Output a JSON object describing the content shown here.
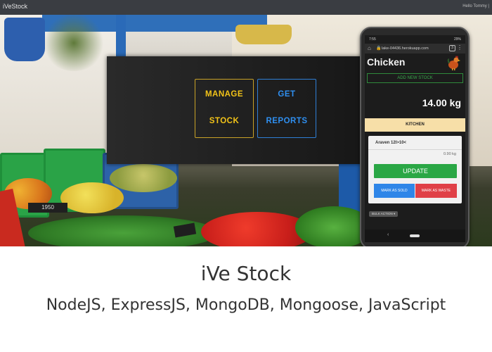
{
  "navbar": {
    "brand": "iVeStock",
    "greeting": "Hello Tommy |"
  },
  "hero": {
    "price_tag": "1950",
    "tiles": [
      {
        "line1": "MANAGE",
        "line2": "STOCK"
      },
      {
        "line1": "GET",
        "line2": "REPORTS"
      }
    ]
  },
  "phone": {
    "status_time": "7:55",
    "status_battery": "29%",
    "url": "lake-04436.herokuapp.com",
    "tab_count": "3",
    "item_title": "Chicken",
    "add_stock": "ADD NEW STOCK",
    "weight": "14.00 kg",
    "location": "KITCHEN",
    "card": {
      "name": "Araven 12l>10<",
      "weight": "0.90 kg",
      "update": "UPDATE",
      "mark_sold": "MARK AS SOLD",
      "mark_waste": "MARK AS WASTE"
    },
    "bulk_action": "BULK ACTION ▾"
  },
  "caption": {
    "title": "iVe Stock",
    "subtitle": "NodeJS, ExpressJS, MongoDB, Mongoose, JavaScript"
  },
  "colors": {
    "navbar": "#3a3d42",
    "manage_tile": "#f2c318",
    "reports_tile": "#2f8ff0",
    "update_button": "#2aa745",
    "sold_button": "#2f86e8",
    "waste_button": "#e04047",
    "location_bar": "#f7dfa8"
  }
}
